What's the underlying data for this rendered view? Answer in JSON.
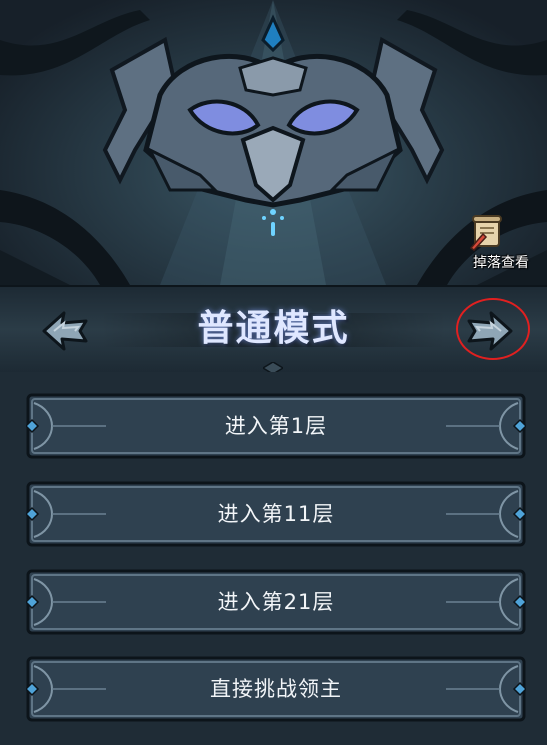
{
  "banner": {
    "boss_icon": "horned-helmet-emblem",
    "drop_view": {
      "label": "掉落查看",
      "icon": "scroll-quill-icon"
    }
  },
  "mode": {
    "title": "普通模式",
    "prev_icon": "arrow-left-icon",
    "next_icon": "arrow-right-icon",
    "next_highlighted": true,
    "highlight_color": "#e02020"
  },
  "floors": [
    {
      "label": "进入第1层"
    },
    {
      "label": "进入第11层"
    },
    {
      "label": "进入第21层"
    },
    {
      "label": "直接挑战领主"
    }
  ],
  "colors": {
    "title_text": "#dfe7ff",
    "button_text": "#f2f5f8",
    "gem_accent": "#4fa3d8",
    "panel_bg": "#1f2c36"
  }
}
